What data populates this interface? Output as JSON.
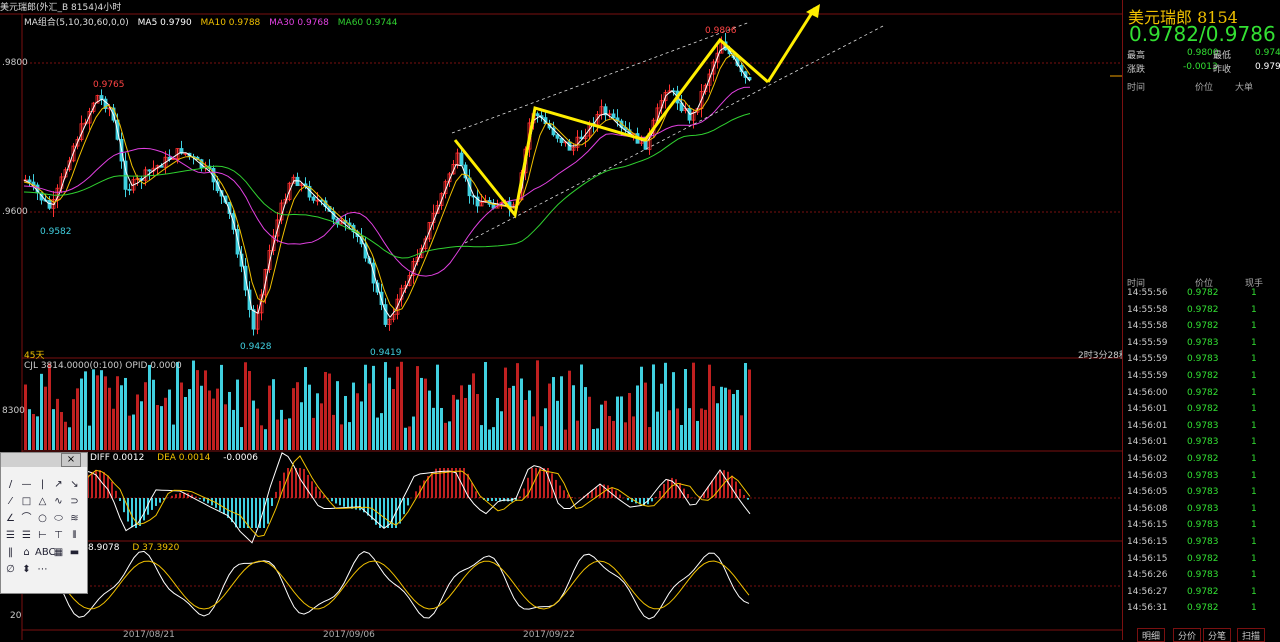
{
  "window": {
    "title": "美元瑞郎(外汇_B 8154)4小时"
  },
  "ma_legend": {
    "group_label": "MA组合(5,10,30,60,0,0)",
    "ma5": "MA5 0.9790",
    "ma10": "MA10 0.9788",
    "ma30": "MA30 0.9768",
    "ma60": "MA60 0.9744"
  },
  "price_axis": {
    "upper": ".9800",
    "lower": ".9600",
    "vol": "8300",
    "kdj_low": "20"
  },
  "annotations": {
    "high1": "0.9765",
    "low1": "0.9582",
    "low2": "0.9428",
    "low3": "0.9419",
    "high2": "0.9806",
    "days": "45天",
    "countdown": "2时3分28秒"
  },
  "volume": {
    "label": "CJL  3814.0000(0:100)   OPID  0.0000"
  },
  "macd": {
    "diff": "DIFF  0.0012",
    "dea": "DEA  0.0014",
    "macd": "-0.0006"
  },
  "kdj": {
    "k": "8.9078",
    "d": "D  37.3920"
  },
  "dates": [
    "2017/08/21",
    "2017/09/06",
    "2017/09/22"
  ],
  "right_panel": {
    "title": "美元瑞郎  8154",
    "price": "0.9782/0.9786",
    "high_label": "最高",
    "high": "0.9800",
    "low_label": "最低",
    "low": "0.974",
    "change_label": "涨跌",
    "change": "-0.0013",
    "prev_label": "昨收",
    "prev": "0.979",
    "big_head": [
      "时间",
      "价位",
      "大单"
    ],
    "tick_head": [
      "时间",
      "价位",
      "现手"
    ],
    "ticks": [
      [
        "14:55:56",
        "0.9782",
        "1"
      ],
      [
        "14:55:58",
        "0.9782",
        "1"
      ],
      [
        "14:55:58",
        "0.9782",
        "1"
      ],
      [
        "14:55:59",
        "0.9783",
        "1"
      ],
      [
        "14:55:59",
        "0.9783",
        "1"
      ],
      [
        "14:55:59",
        "0.9782",
        "1"
      ],
      [
        "14:56:00",
        "0.9782",
        "1"
      ],
      [
        "14:56:01",
        "0.9782",
        "1"
      ],
      [
        "14:56:01",
        "0.9783",
        "1"
      ],
      [
        "14:56:01",
        "0.9783",
        "1"
      ],
      [
        "14:56:02",
        "0.9782",
        "1"
      ],
      [
        "14:56:03",
        "0.9783",
        "1"
      ],
      [
        "14:56:05",
        "0.9783",
        "1"
      ],
      [
        "14:56:08",
        "0.9783",
        "1"
      ],
      [
        "14:56:15",
        "0.9783",
        "1"
      ],
      [
        "14:56:15",
        "0.9783",
        "1"
      ],
      [
        "14:56:15",
        "0.9782",
        "1"
      ],
      [
        "14:56:26",
        "0.9783",
        "1"
      ],
      [
        "14:56:27",
        "0.9782",
        "1"
      ],
      [
        "14:56:31",
        "0.9782",
        "1"
      ]
    ],
    "tabs": [
      "明细",
      "分价",
      "分笔",
      "扫描"
    ]
  },
  "toolbox": {
    "close": "×",
    "tools": [
      "/",
      "—",
      "|",
      "↗",
      "↘",
      "⁄",
      "□",
      "△",
      "∿",
      "⊃",
      "∠",
      "⌒",
      "○",
      "⬭",
      "≋",
      "☰",
      "☰",
      "⊢",
      "⊤",
      "⦀",
      "‖",
      "⌂",
      "ABC",
      "▦",
      "▬",
      "∅",
      "⬍",
      "⋯"
    ]
  },
  "colors": {
    "bg": "#000000",
    "up": "#ff3030",
    "down": "#40d0e0",
    "ma5": "#ffffff",
    "ma10": "#f0c000",
    "ma30": "#e040e0",
    "ma60": "#30d030",
    "arrow": "#ffee00",
    "grid": "#7a1010"
  }
}
